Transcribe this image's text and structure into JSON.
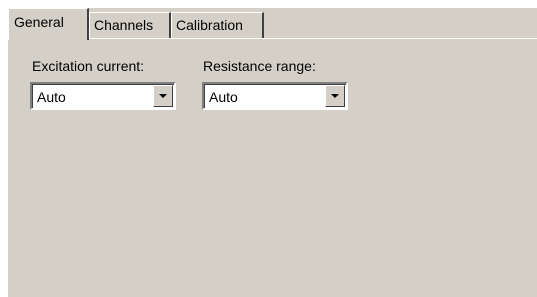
{
  "tabs": [
    {
      "label": "General",
      "active": true
    },
    {
      "label": "Channels",
      "active": false
    },
    {
      "label": "Calibration",
      "active": false
    }
  ],
  "excitation": {
    "label": "Excitation current:",
    "value": "Auto"
  },
  "resistance": {
    "label": "Resistance range:",
    "value": "Auto"
  },
  "icons": {
    "dropdown": "chevron-down-icon"
  },
  "colors": {
    "face": "#d4d0c8",
    "highlight": "#ffffff",
    "shadow": "#808080",
    "dark_shadow": "#404040"
  }
}
